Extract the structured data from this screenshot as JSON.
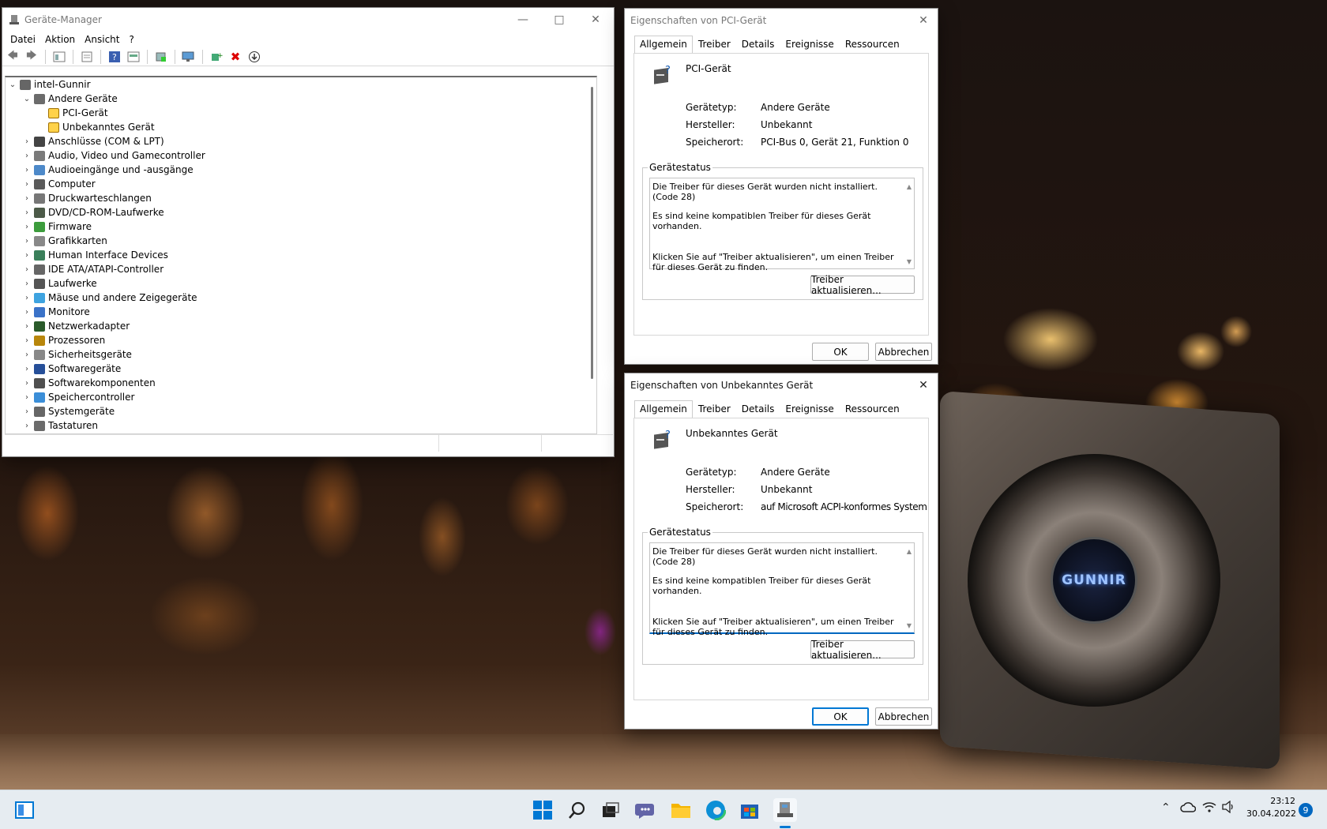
{
  "device_manager": {
    "title": "Geräte-Manager",
    "menu": [
      "Datei",
      "Aktion",
      "Ansicht",
      "?"
    ],
    "root": "intel-Gunnir",
    "categories": [
      {
        "label": "Andere Geräte",
        "expanded": true,
        "children": [
          "PCI-Gerät",
          "Unbekanntes Gerät"
        ]
      },
      {
        "label": "Anschlüsse (COM & LPT)"
      },
      {
        "label": "Audio, Video und Gamecontroller"
      },
      {
        "label": "Audioeingänge und -ausgänge"
      },
      {
        "label": "Computer"
      },
      {
        "label": "Druckwarteschlangen"
      },
      {
        "label": "DVD/CD-ROM-Laufwerke"
      },
      {
        "label": "Firmware"
      },
      {
        "label": "Grafikkarten"
      },
      {
        "label": "Human Interface Devices"
      },
      {
        "label": "IDE ATA/ATAPI-Controller"
      },
      {
        "label": "Laufwerke"
      },
      {
        "label": "Mäuse und andere Zeigegeräte"
      },
      {
        "label": "Monitore"
      },
      {
        "label": "Netzwerkadapter"
      },
      {
        "label": "Prozessoren"
      },
      {
        "label": "Sicherheitsgeräte"
      },
      {
        "label": "Softwaregeräte"
      },
      {
        "label": "Softwarekomponenten"
      },
      {
        "label": "Speichercontroller"
      },
      {
        "label": "Systemgeräte"
      },
      {
        "label": "Tastaturen"
      }
    ]
  },
  "dialog_pci": {
    "title": "Eigenschaften von PCI-Gerät",
    "tabs": [
      "Allgemein",
      "Treiber",
      "Details",
      "Ereignisse",
      "Ressourcen"
    ],
    "device_name": "PCI-Gerät",
    "type_label": "Gerätetyp:",
    "type_value": "Andere Geräte",
    "vendor_label": "Hersteller:",
    "vendor_value": "Unbekannt",
    "location_label": "Speicherort:",
    "location_value": "PCI-Bus 0, Gerät 21, Funktion 0",
    "status_legend": "Gerätestatus",
    "status_line1": "Die Treiber für dieses Gerät wurden nicht installiert. (Code 28)",
    "status_line2": "Es sind keine kompatiblen Treiber für dieses Gerät vorhanden.",
    "status_line3": "Klicken Sie auf \"Treiber aktualisieren\", um einen Treiber für dieses Gerät zu finden.",
    "update_button": "Treiber aktualisieren...",
    "ok": "OK",
    "cancel": "Abbrechen"
  },
  "dialog_unknown": {
    "title": "Eigenschaften von Unbekanntes Gerät",
    "tabs": [
      "Allgemein",
      "Treiber",
      "Details",
      "Ereignisse",
      "Ressourcen"
    ],
    "device_name": "Unbekanntes Gerät",
    "type_label": "Gerätetyp:",
    "type_value": "Andere Geräte",
    "vendor_label": "Hersteller:",
    "vendor_value": "Unbekannt",
    "location_label": "Speicherort:",
    "location_value": "auf Microsoft ACPI-konformes System",
    "status_legend": "Gerätestatus",
    "status_line1": "Die Treiber für dieses Gerät wurden nicht installiert. (Code 28)",
    "status_line2": "Es sind keine kompatiblen Treiber für dieses Gerät vorhanden.",
    "status_line3": "Klicken Sie auf \"Treiber aktualisieren\", um einen Treiber für dieses Gerät zu finden.",
    "update_button": "Treiber aktualisieren...",
    "ok": "OK",
    "cancel": "Abbrechen"
  },
  "wallpaper": {
    "gpu_logo": "GUNNIR"
  },
  "taskbar": {
    "time": "23:12",
    "date": "30.04.2022",
    "notification_count": "9",
    "accent": "#0078d4"
  }
}
